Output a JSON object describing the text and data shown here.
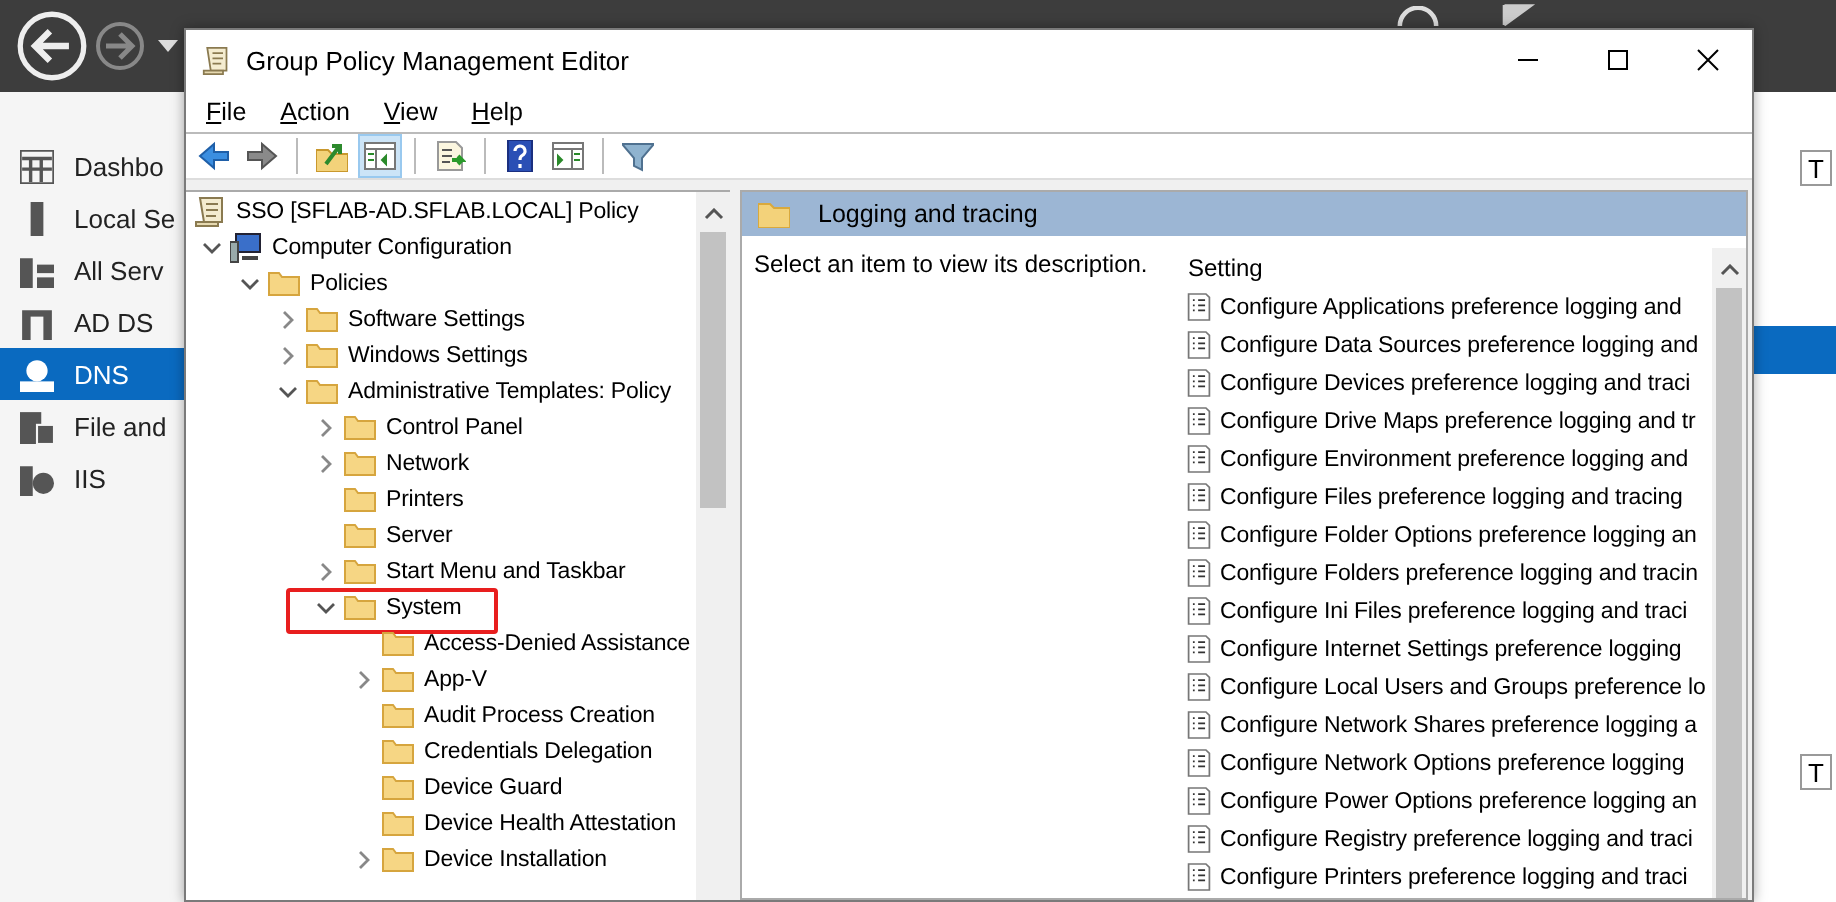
{
  "server_manager": {
    "sidebar": {
      "items": [
        {
          "label": "Dashbo",
          "selected": false
        },
        {
          "label": "Local Se",
          "selected": false
        },
        {
          "label": "All Serv",
          "selected": false
        },
        {
          "label": "AD DS",
          "selected": false
        },
        {
          "label": "DNS",
          "selected": true
        },
        {
          "label": "File and",
          "selected": false
        },
        {
          "label": "IIS",
          "selected": false
        }
      ]
    },
    "right_buttons": [
      "T",
      "T"
    ]
  },
  "window": {
    "title": "Group Policy Management Editor",
    "menu": [
      "File",
      "Action",
      "View",
      "Help"
    ],
    "toolbar": [
      {
        "kind": "back",
        "pressed": false
      },
      {
        "kind": "forward",
        "pressed": false
      },
      {
        "kind": "sep"
      },
      {
        "kind": "up",
        "pressed": false
      },
      {
        "kind": "tree",
        "pressed": true
      },
      {
        "kind": "sep"
      },
      {
        "kind": "export",
        "pressed": false
      },
      {
        "kind": "sep"
      },
      {
        "kind": "help",
        "pressed": false
      },
      {
        "kind": "pane",
        "pressed": false
      },
      {
        "kind": "sep"
      },
      {
        "kind": "filter",
        "pressed": false
      }
    ],
    "tree": [
      {
        "label": "SSO [SFLAB-AD.SFLAB.LOCAL] Policy",
        "kind": "policy",
        "children": [
          {
            "label": "Computer Configuration",
            "kind": "computer",
            "expanded": true,
            "children": [
              {
                "label": "Policies",
                "kind": "folder",
                "expanded": true,
                "children": [
                  {
                    "label": "Software Settings",
                    "kind": "folder",
                    "expanded": false
                  },
                  {
                    "label": "Windows Settings",
                    "kind": "folder",
                    "expanded": false
                  },
                  {
                    "label": "Administrative Templates: Policy",
                    "kind": "folder",
                    "expanded": true,
                    "children": [
                      {
                        "label": "Control Panel",
                        "kind": "folder",
                        "expanded": false
                      },
                      {
                        "label": "Network",
                        "kind": "folder",
                        "expanded": false
                      },
                      {
                        "label": "Printers",
                        "kind": "folder"
                      },
                      {
                        "label": "Server",
                        "kind": "folder"
                      },
                      {
                        "label": "Start Menu and Taskbar",
                        "kind": "folder",
                        "expanded": false
                      },
                      {
                        "label": "System",
                        "kind": "folder",
                        "expanded": true,
                        "highlighted": true,
                        "children": [
                          {
                            "label": "Access-Denied Assistance",
                            "kind": "folder"
                          },
                          {
                            "label": "App-V",
                            "kind": "folder",
                            "expanded": false
                          },
                          {
                            "label": "Audit Process Creation",
                            "kind": "folder"
                          },
                          {
                            "label": "Credentials Delegation",
                            "kind": "folder"
                          },
                          {
                            "label": "Device Guard",
                            "kind": "folder"
                          },
                          {
                            "label": "Device Health Attestation",
                            "kind": "folder"
                          },
                          {
                            "label": "Device Installation",
                            "kind": "folder",
                            "expanded": false
                          }
                        ]
                      }
                    ]
                  }
                ]
              }
            ]
          }
        ]
      }
    ],
    "details": {
      "title": "Logging and tracing",
      "description": "Select an item to view its description.",
      "column": "Setting",
      "settings": [
        "Configure Applications preference logging and",
        "Configure Data Sources preference logging and",
        "Configure Devices preference logging and traci",
        "Configure Drive Maps preference logging and tr",
        "Configure Environment preference logging and",
        "Configure Files preference logging and tracing",
        "Configure Folder Options preference logging an",
        "Configure Folders preference logging and tracin",
        "Configure Ini Files preference logging and traci",
        "Configure Internet Settings preference logging",
        "Configure Local Users and Groups preference lo",
        "Configure Network Shares preference logging a",
        "Configure Network Options preference logging",
        "Configure Power Options preference logging an",
        "Configure Registry preference logging and traci",
        "Configure Printers preference logging and traci"
      ]
    }
  }
}
